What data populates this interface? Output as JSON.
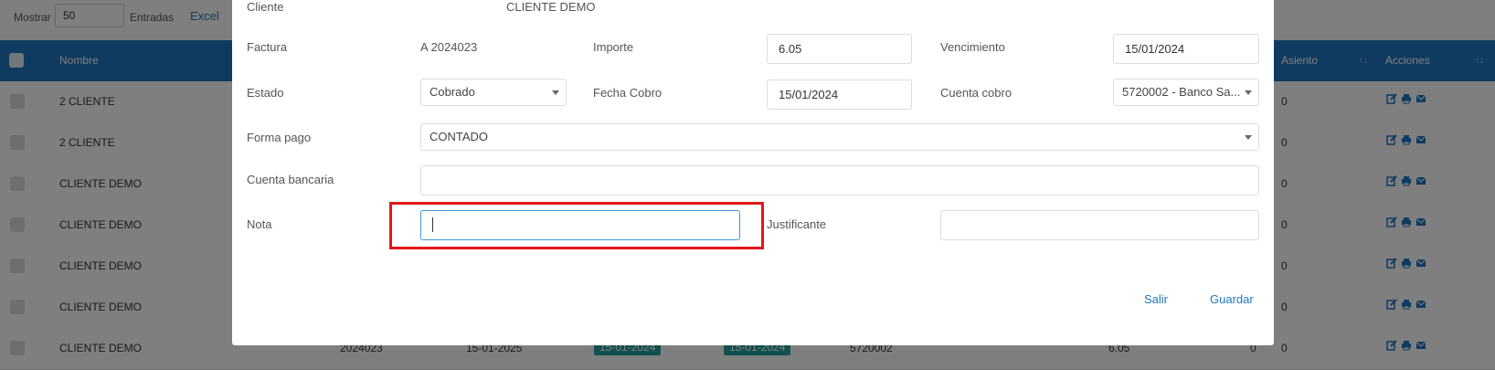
{
  "toolbar": {
    "mostrar_label": "Mostrar",
    "mostrar_value": "50",
    "entradas_label": "Entradas",
    "excel_label": "Excel"
  },
  "table": {
    "headers": {
      "nombre": "Nombre",
      "asiento": "Asiento",
      "acciones": "Acciones"
    },
    "rows": [
      {
        "nombre": "2 CLIENTE",
        "asiento": "0"
      },
      {
        "nombre": "2 CLIENTE",
        "asiento": "0"
      },
      {
        "nombre": "CLIENTE DEMO",
        "asiento": "0"
      },
      {
        "nombre": "CLIENTE DEMO",
        "asiento": "0"
      },
      {
        "nombre": "CLIENTE DEMO",
        "asiento": "0"
      },
      {
        "nombre": "CLIENTE DEMO",
        "asiento": "0"
      },
      {
        "nombre": "CLIENTE DEMO",
        "asiento": "0"
      }
    ],
    "last_row": {
      "factura": "2024023",
      "fecha": "15-01-2025",
      "badge1": "15-01-2024",
      "badge2": "15-01-2024",
      "cuenta": "5720002",
      "importe": "6.05",
      "extra": "0"
    }
  },
  "modal": {
    "cliente_label": "Cliente",
    "cliente_value": "CLIENTE DEMO",
    "factura_label": "Factura",
    "factura_value": "A 2024023",
    "importe_label": "Importe",
    "importe_value": "6.05",
    "vencimiento_label": "Vencimiento",
    "vencimiento_value": "15/01/2024",
    "estado_label": "Estado",
    "estado_value": "Cobrado",
    "fecha_cobro_label": "Fecha Cobro",
    "fecha_cobro_value": "15/01/2024",
    "cuenta_cobro_label": "Cuenta cobro",
    "cuenta_cobro_value": "5720002 - Banco Sa...",
    "forma_pago_label": "Forma pago",
    "forma_pago_value": "CONTADO",
    "cuenta_bancaria_label": "Cuenta bancaria",
    "cuenta_bancaria_value": "",
    "nota_label": "Nota",
    "nota_value": "",
    "justificante_label": "Justificante",
    "justificante_value": "",
    "salir_label": "Salir",
    "guardar_label": "Guardar"
  },
  "colors": {
    "header_bg": "#1f76c0",
    "badge_bg": "#20a39e",
    "highlight": "#e3171a",
    "link": "#1f76c0"
  },
  "icons": [
    "edit-icon",
    "print-icon",
    "mail-icon"
  ]
}
